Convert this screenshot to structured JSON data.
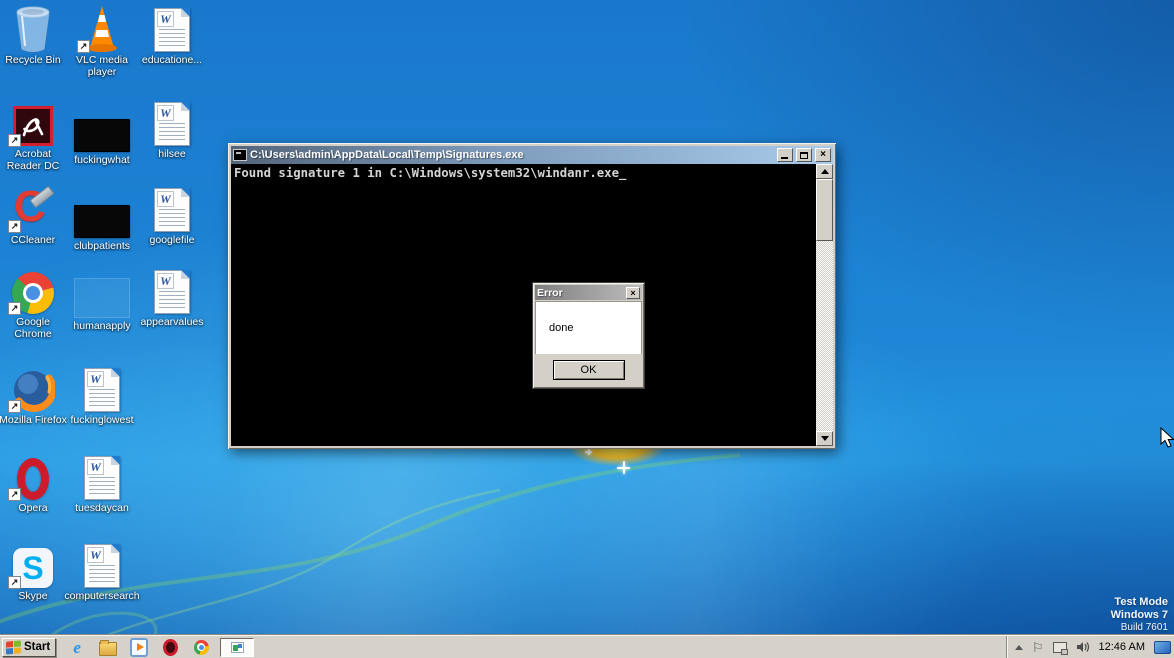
{
  "desktop": {
    "icons": [
      {
        "label": "Recycle Bin",
        "type": "recycle-bin"
      },
      {
        "label": "VLC media player",
        "type": "vlc"
      },
      {
        "label": "educatione...",
        "type": "word-doc"
      },
      {
        "label": "Acrobat Reader DC",
        "type": "acrobat"
      },
      {
        "label": "fuckingwhat",
        "type": "video-thumbnail"
      },
      {
        "label": "hilsee",
        "type": "word-doc"
      },
      {
        "label": "CCleaner",
        "type": "ccleaner"
      },
      {
        "label": "clubpatients",
        "type": "video-thumbnail"
      },
      {
        "label": "googlefile",
        "type": "word-doc"
      },
      {
        "label": "Google Chrome",
        "type": "chrome"
      },
      {
        "label": "humanapply",
        "type": "ghost-thumbnail"
      },
      {
        "label": "appearvalues",
        "type": "word-doc"
      },
      {
        "label": "Mozilla Firefox",
        "type": "firefox"
      },
      {
        "label": "fuckinglowest",
        "type": "word-doc"
      },
      {
        "label": "Opera",
        "type": "opera"
      },
      {
        "label": "tuesdaycan",
        "type": "word-doc"
      },
      {
        "label": "Skype",
        "type": "skype"
      },
      {
        "label": "computersearch",
        "type": "word-doc"
      }
    ],
    "watermark": {
      "line1": "Test Mode",
      "line2": "Windows 7",
      "line3": "Build 7601"
    }
  },
  "console_window": {
    "title": "C:\\Users\\admin\\AppData\\Local\\Temp\\Signatures.exe",
    "output_line": "Found signature 1 in C:\\Windows\\system32\\windanr.exe_"
  },
  "error_dialog": {
    "title": "Error",
    "message": "done",
    "ok_label": "OK"
  },
  "window_controls": {
    "close_glyph": "×"
  },
  "taskbar": {
    "start_label": "Start",
    "quick_launch_icons": [
      "internet-explorer-icon",
      "windows-explorer-icon",
      "media-player-icon",
      "opera-icon",
      "chrome-icon"
    ],
    "task_button_icon": "signatures-app-icon",
    "tray_icons": [
      "hidden-icons-arrow-icon",
      "action-center-flag-icon",
      "network-icon",
      "volume-icon",
      "display-icon"
    ],
    "tray": {
      "time": "12:46 AM"
    }
  },
  "colors": {
    "desktop_blue": "#1e86d6",
    "taskbar_bg": "#d6d2ca",
    "console_title_gradient_left": "#53657b",
    "console_title_gradient_right": "#a9cbe9",
    "console_text": "#d4d4d4",
    "dialog_bg": "#d4d0c8",
    "gold_glow": "#e9b92b"
  }
}
